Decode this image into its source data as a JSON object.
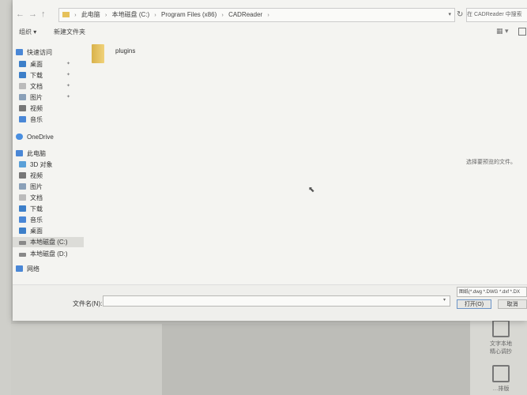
{
  "address_bar": {
    "segments": [
      "此电脑",
      "本地磁盘 (C:)",
      "Program Files (x86)",
      "CADReader"
    ],
    "search_placeholder": "在 CADReader 中搜索"
  },
  "toolbar": {
    "organize_label": "组织 ▾",
    "new_folder_label": "新建文件夹",
    "view_icon": "▦ ▾"
  },
  "nav_pane": {
    "quick_access_label": "快速访问",
    "quick_access_items": [
      "桌面",
      "下载",
      "文档",
      "图片",
      "视频",
      "音乐"
    ],
    "onedrive_label": "OneDrive",
    "this_pc_label": "此电脑",
    "this_pc_items": [
      "3D 对象",
      "视频",
      "图片",
      "文档",
      "下载",
      "音乐",
      "桌面",
      "本地磁盘 (C:)",
      "本地磁盘 (D:)"
    ],
    "network_label": "网络"
  },
  "content": {
    "items": [
      {
        "name": "plugins",
        "icon": "folder-icon"
      }
    ],
    "preview_hint": "选择要预览的文件。"
  },
  "bottom_bar": {
    "filename_label": "文件名(N):",
    "filename_value": "",
    "filetype_value": "图纸(*.dwg *.DWG *.dxf *.DX",
    "open_label": "打开(O)",
    "cancel_label": "取消"
  },
  "background_app": {
    "tool1_label": "文字本地\n精心调抄",
    "tool2_label": "…排版"
  },
  "colors": {
    "folder": "#e6c15a",
    "accent_border": "#6c95c8",
    "selected_bg": "#dcdcd8"
  }
}
